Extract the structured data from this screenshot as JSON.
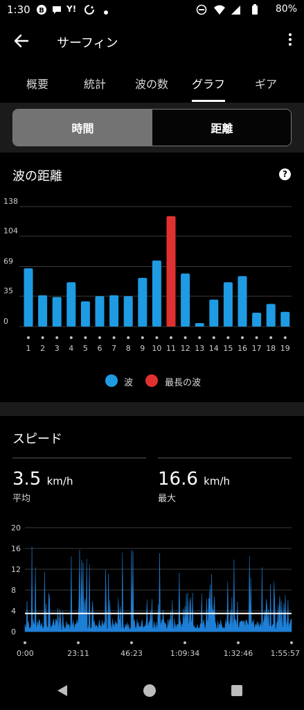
{
  "status_bar": {
    "time": "1:30",
    "icons": [
      "notification-b-icon",
      "chat-icon",
      "yahoo-icon",
      "sync-icon",
      "dot-icon",
      "dnd-icon",
      "wifi-icon",
      "signal-icon",
      "battery-icon"
    ],
    "yahoo_text": "Y!",
    "battery": "80%"
  },
  "app_bar": {
    "title": "サーフィン"
  },
  "tabs": [
    {
      "label": "概要",
      "active": false
    },
    {
      "label": "統計",
      "active": false
    },
    {
      "label": "波の数",
      "active": false
    },
    {
      "label": "グラフ",
      "active": true
    },
    {
      "label": "ギア",
      "active": false
    }
  ],
  "segment": {
    "time_label": "時間",
    "distance_label": "距離",
    "selected": "時間"
  },
  "waves_section": {
    "title": "波の距離",
    "help": "?",
    "legend": [
      {
        "label": "波",
        "color": "#1e9be2"
      },
      {
        "label": "最長の波",
        "color": "#e03131"
      }
    ]
  },
  "speed_section": {
    "title": "スピード",
    "average": {
      "value": "3.5",
      "unit": "km/h",
      "label": "平均"
    },
    "max": {
      "value": "16.6",
      "unit": "km/h",
      "label": "最大"
    }
  },
  "chart_data": [
    {
      "type": "bar",
      "categories": [
        "1",
        "2",
        "3",
        "4",
        "5",
        "6",
        "7",
        "8",
        "9",
        "10",
        "11",
        "12",
        "13",
        "14",
        "15",
        "16",
        "17",
        "18",
        "19"
      ],
      "values": [
        67,
        36,
        34,
        51,
        29,
        35,
        36,
        35,
        56,
        76,
        127,
        61,
        4,
        31,
        51,
        58,
        16,
        26,
        17
      ],
      "highlight_index": 10,
      "colors": {
        "bar": "#1e9be2",
        "highlight": "#e03131"
      },
      "yticks": [
        0,
        35,
        69,
        104,
        138
      ],
      "ylim": [
        0,
        138
      ],
      "grid": true
    },
    {
      "type": "area",
      "x_ticks": [
        "0:00",
        "23:11",
        "46:23",
        "1:09:34",
        "1:32:46",
        "1:55:57"
      ],
      "yticks": [
        0,
        4,
        8,
        12,
        16,
        20
      ],
      "ylim": [
        0,
        20
      ],
      "average_line": 3.5,
      "max": 16.6,
      "colors": {
        "fill": "#1e7fd6",
        "average": "#ffffff"
      },
      "grid": true
    }
  ]
}
